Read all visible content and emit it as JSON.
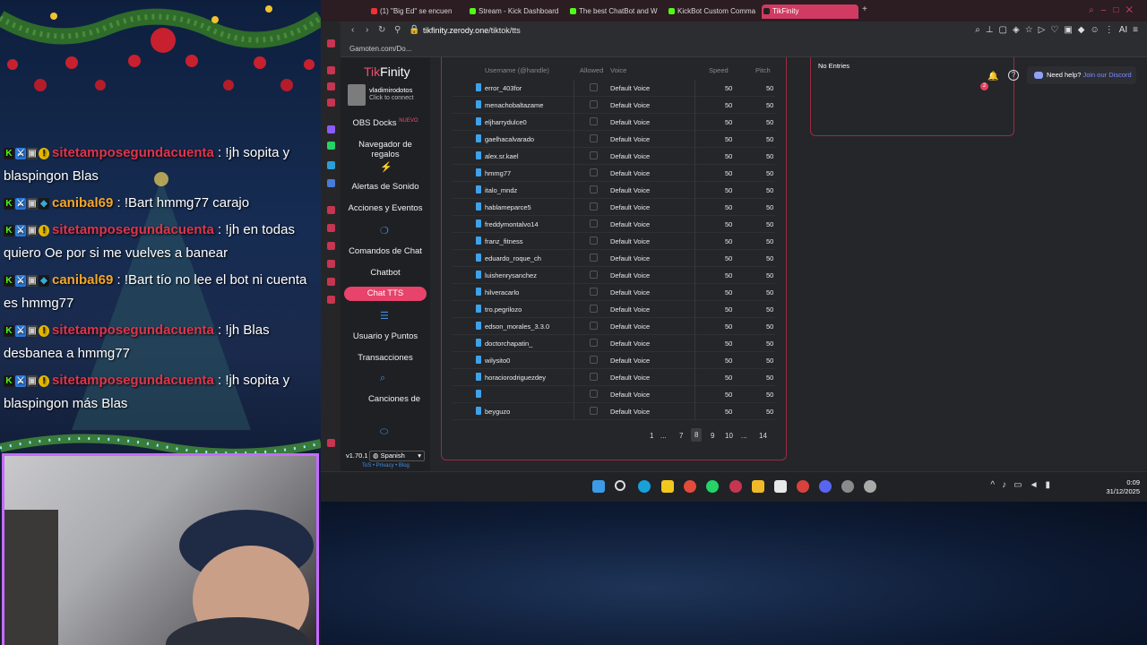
{
  "chat": {
    "messages": [
      {
        "user": "sitetamposegundacuenta",
        "text": ": !jh sopita y blaspingon Blas",
        "color": "#e0344a"
      },
      {
        "user": "canibal69",
        "text": ": !Bart hmmg77 carajo",
        "color": "#f4a62a"
      },
      {
        "user": "sitetamposegundacuenta",
        "text": ": !jh en todas quiero Oe por si me vuelves a banear",
        "color": "#e0344a"
      },
      {
        "user": "canibal69",
        "text": ": !Bart tío no lee el bot ni cuenta es hmmg77",
        "color": "#f4a62a"
      },
      {
        "user": "sitetamposegundacuenta",
        "text": ": !jh Blas desbanea a hmmg77",
        "color": "#e0344a"
      },
      {
        "user": "sitetamposegundacuenta",
        "text": ": !jh sopita y blaspingon más Blas",
        "color": "#e0344a"
      }
    ]
  },
  "browser": {
    "tabs": [
      {
        "label": "(1) \"Big Ed\" se encuen"
      },
      {
        "label": "Stream - Kick Dashboard"
      },
      {
        "label": "The best ChatBot and Wi"
      },
      {
        "label": "KickBot Custom Comma"
      },
      {
        "label": "TikFinity"
      }
    ],
    "new_tab": "+",
    "url_host": "tikfinity.zerody.one",
    "url_path": "/tiktok/tts",
    "bookmark": "Gamoten.com/Do...",
    "extension_label": "AI"
  },
  "app": {
    "brand_a": "Tik",
    "brand_b": "Finity",
    "profile_name": "vladimirodotos",
    "profile_sub": "Click to connect",
    "menu": {
      "obs_docks": "OBS Docks",
      "nuevo": "NUEVO",
      "navegador": "Navegador de regalos",
      "alertas": "Alertas de Sonido",
      "acciones": "Acciones y Eventos",
      "comandos": "Comandos de Chat",
      "chatbot": "Chatbot",
      "chat_tts": "Chat TTS",
      "usuarios": "Usuario y Puntos",
      "transacciones": "Transacciones",
      "canciones": "Canciones de"
    },
    "version": "v1.70.1",
    "language": "Spanish",
    "tos": "ToS • Privacy • Blog"
  },
  "table": {
    "headers": {
      "username": "Username (@handle)",
      "allowed": "Allowed",
      "voice": "Voice",
      "speed": "Speed",
      "pitch": "Pitch"
    },
    "rows": [
      {
        "user": "error_403for",
        "voice": "Default Voice",
        "speed": "50",
        "pitch": "50"
      },
      {
        "user": "menachobaltazame",
        "voice": "Default Voice",
        "speed": "50",
        "pitch": "50"
      },
      {
        "user": "eljharrydulce0",
        "voice": "Default Voice",
        "speed": "50",
        "pitch": "50"
      },
      {
        "user": "gaelhacalvarado",
        "voice": "Default Voice",
        "speed": "50",
        "pitch": "50"
      },
      {
        "user": "alex.sr.kael",
        "voice": "Default Voice",
        "speed": "50",
        "pitch": "50"
      },
      {
        "user": "hmmg77",
        "voice": "Default Voice",
        "speed": "50",
        "pitch": "50"
      },
      {
        "user": "italo_mndz",
        "voice": "Default Voice",
        "speed": "50",
        "pitch": "50"
      },
      {
        "user": "hablameparce5",
        "voice": "Default Voice",
        "speed": "50",
        "pitch": "50"
      },
      {
        "user": "freddymontalvo14",
        "voice": "Default Voice",
        "speed": "50",
        "pitch": "50"
      },
      {
        "user": "franz_fitness",
        "voice": "Default Voice",
        "speed": "50",
        "pitch": "50"
      },
      {
        "user": "eduardo_roque_ch",
        "voice": "Default Voice",
        "speed": "50",
        "pitch": "50"
      },
      {
        "user": "luishenrysanchez",
        "voice": "Default Voice",
        "speed": "50",
        "pitch": "50"
      },
      {
        "user": "hilveracarlo",
        "voice": "Default Voice",
        "speed": "50",
        "pitch": "50"
      },
      {
        "user": "tro.pegrilozo",
        "voice": "Default Voice",
        "speed": "50",
        "pitch": "50"
      },
      {
        "user": "edson_morales_3.3.0",
        "voice": "Default Voice",
        "speed": "50",
        "pitch": "50"
      },
      {
        "user": "doctorchapatin_",
        "voice": "Default Voice",
        "speed": "50",
        "pitch": "50"
      },
      {
        "user": "wilysito0",
        "voice": "Default Voice",
        "speed": "50",
        "pitch": "50"
      },
      {
        "user": "horaciorodriguezdey",
        "voice": "Default Voice",
        "speed": "50",
        "pitch": "50"
      },
      {
        "user": "",
        "voice": "Default Voice",
        "speed": "50",
        "pitch": "50"
      },
      {
        "user": "beyguzo",
        "voice": "Default Voice",
        "speed": "50",
        "pitch": "50"
      }
    ],
    "pagination": {
      "p1": "1",
      "dots1": "...",
      "p7": "7",
      "p8": "8",
      "p9": "9",
      "p10": "10",
      "dots2": "...",
      "p14": "14"
    }
  },
  "side": {
    "no_entries": "No Entries",
    "bell_count": "2",
    "need_help": "Need help?",
    "discord_link": "Join our Discord"
  },
  "taskbar": {
    "time": "0:09",
    "date": "31/12/2025"
  },
  "colors": {
    "accent": "#e8436a",
    "brand": "#e9506f",
    "link": "#3f8fe0",
    "border": "#9d2b44"
  }
}
